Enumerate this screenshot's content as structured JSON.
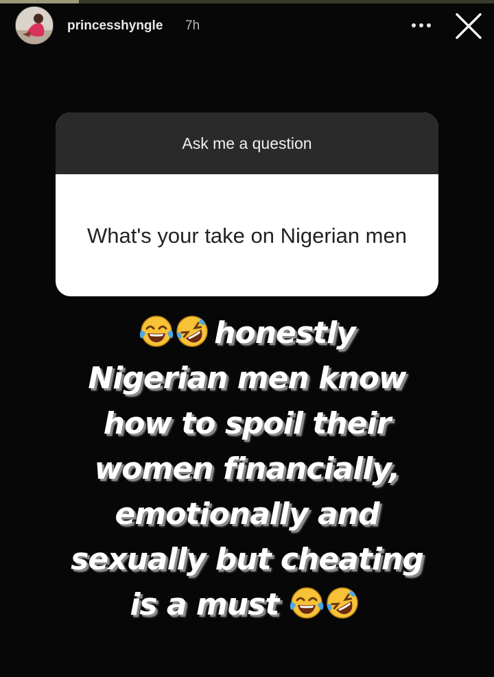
{
  "story": {
    "progress_fraction": 0.16,
    "username": "princesshyngle",
    "timestamp": "7h"
  },
  "question_sticker": {
    "header": "Ask me a question",
    "question": "What's your take on Nigerian men"
  },
  "answer": {
    "lines": [
      "honestly",
      "Nigerian men know",
      "how to spoil their",
      "women financially,",
      "emotionally and",
      "sexually but cheating",
      "is a must"
    ]
  },
  "icons": {
    "more": "more-options-icon",
    "close": "close-icon",
    "emoji_1": "face-with-tears-of-joy-emoji",
    "emoji_2": "rolling-on-the-floor-laughing-emoji"
  },
  "colors": {
    "background": "#070707",
    "card_header": "#2a2a2a",
    "card_body": "#ffffff"
  }
}
